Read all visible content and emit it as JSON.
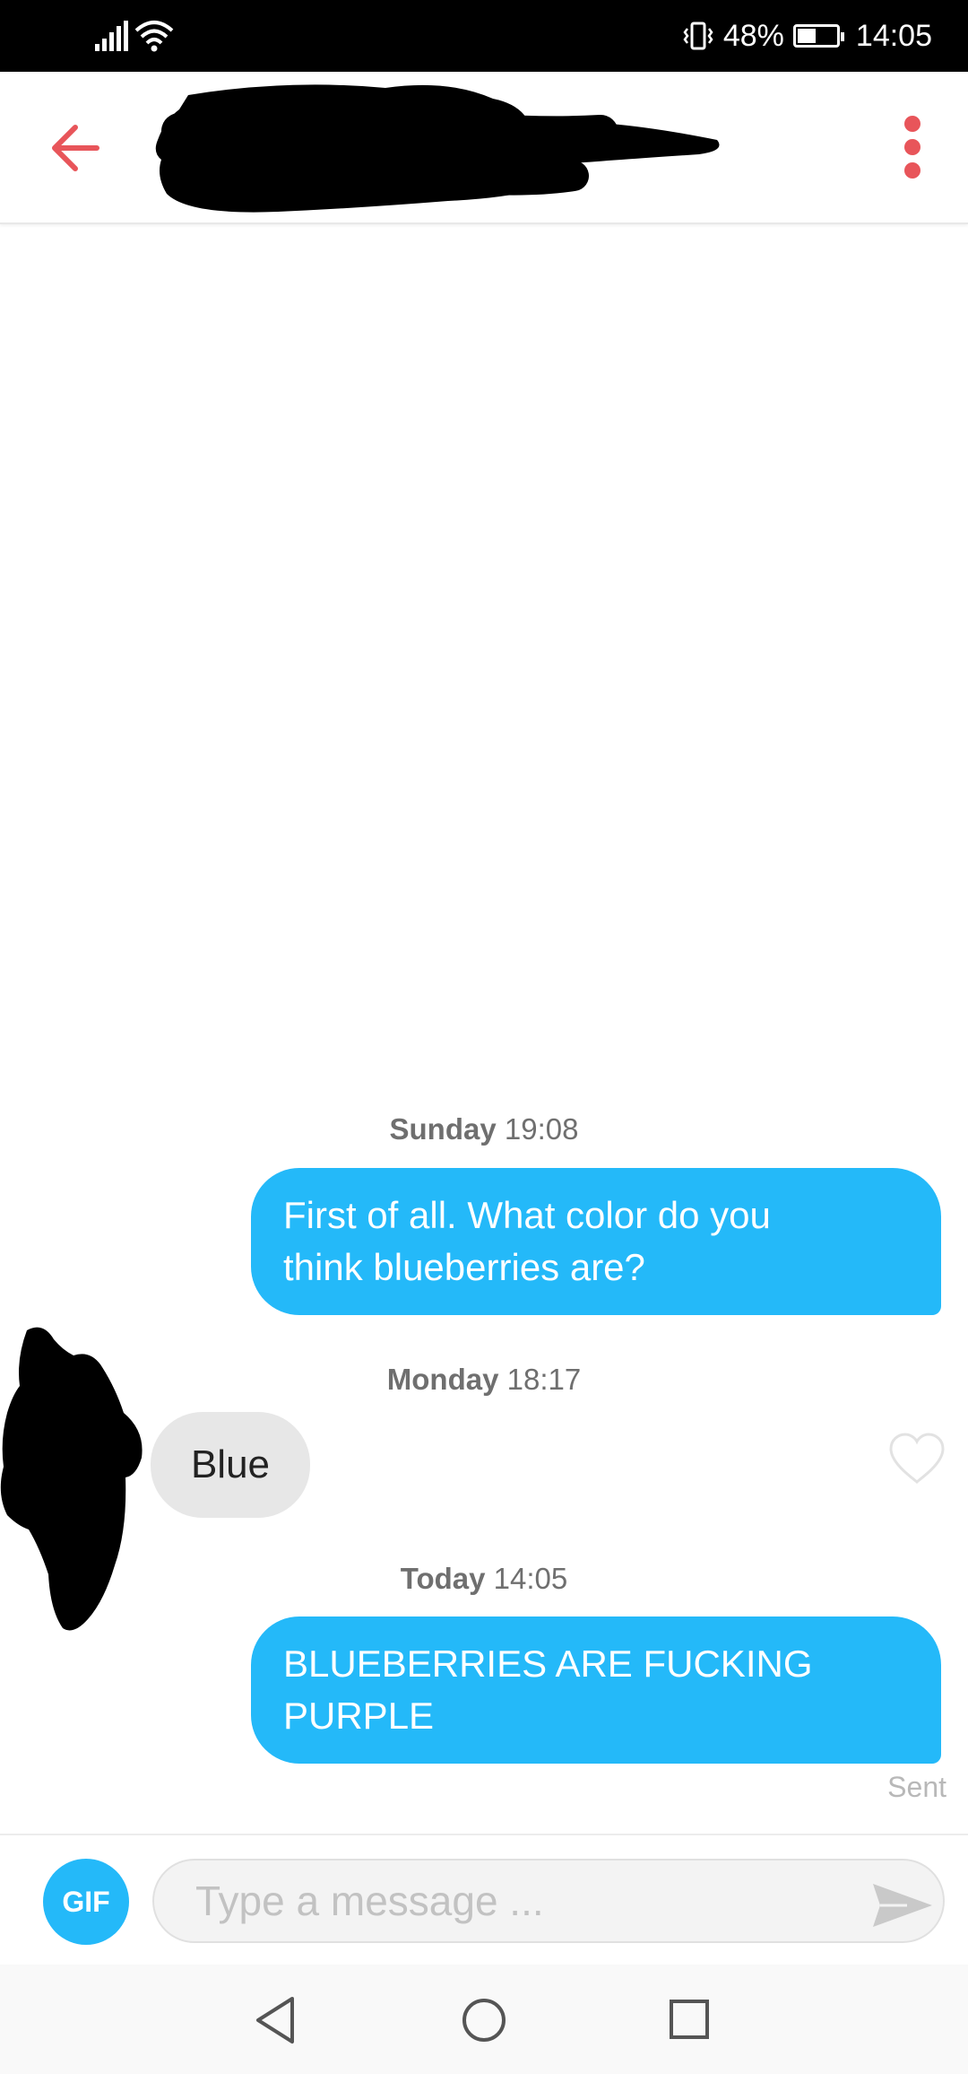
{
  "status_bar": {
    "battery_percent": "48%",
    "battery_level": 0.48,
    "time": "14:05",
    "icons": [
      "signal-icon",
      "wifi-icon",
      "vibrate-icon",
      "battery-icon"
    ]
  },
  "header": {
    "icons": [
      "back-arrow-icon",
      "more-options-icon"
    ],
    "name_redacted": true
  },
  "messages": [
    {
      "timestamp_day": "Sunday",
      "timestamp_time": "19:08",
      "direction": "outgoing",
      "lines": [
        "First of all. What color do you",
        "think blueberries are?"
      ]
    },
    {
      "timestamp_day": "Monday",
      "timestamp_time": "18:17",
      "direction": "incoming",
      "text": "Blue"
    },
    {
      "timestamp_day": "Today",
      "timestamp_time": "14:05",
      "direction": "outgoing",
      "lines": [
        "BLUEBERRIES ARE FUCKING",
        "PURPLE"
      ]
    }
  ],
  "delivery_status": "Sent",
  "composer": {
    "gif_label": "GIF",
    "placeholder": "Type a message ..."
  },
  "colors": {
    "accent_red": "#e8555a",
    "bubble_blue": "#24b9f9",
    "bubble_grey": "#e7e7e7"
  },
  "nav_bar": {
    "icons": [
      "back-triangle-icon",
      "home-circle-icon",
      "recents-square-icon"
    ]
  }
}
